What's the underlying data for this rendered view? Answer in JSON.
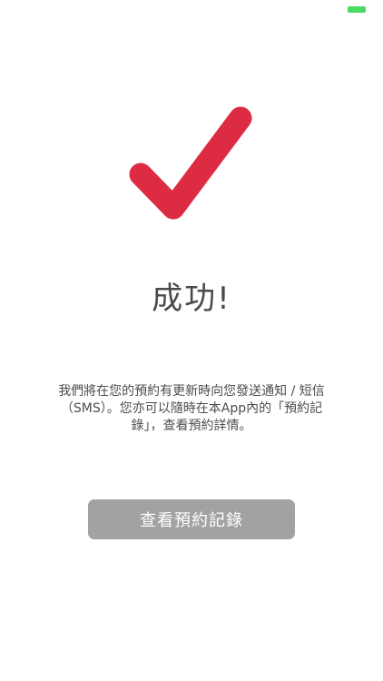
{
  "status_bar": {
    "battery_color": "#4cd964"
  },
  "success": {
    "icon": "checkmark-icon",
    "icon_color": "#dc2b43",
    "title": "成功!",
    "message": "我們將在您的預約有更新時向您發送通知 / 短信（SMS）。您亦可以隨時在本App內的「預約記錄」，查看預約詳情。"
  },
  "actions": {
    "view_records_label": "查看預約記錄",
    "button_color": "#a2a2a2"
  }
}
